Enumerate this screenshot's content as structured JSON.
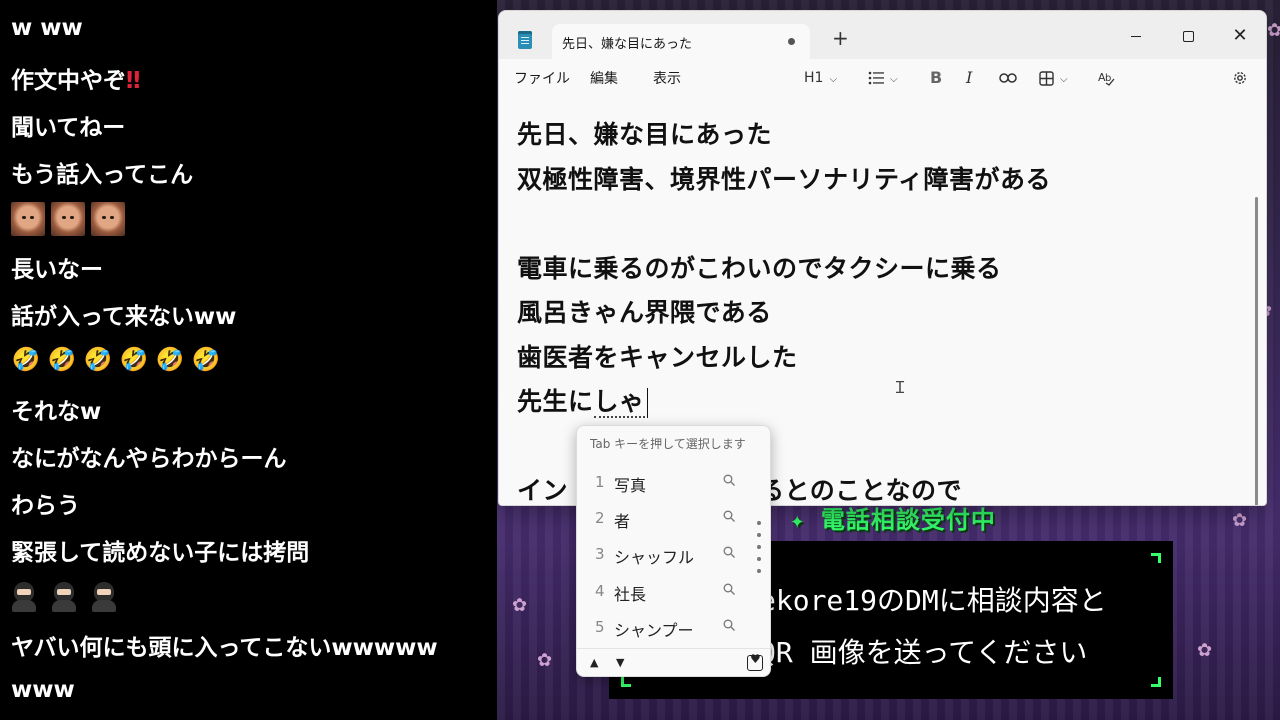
{
  "chat": {
    "lines": [
      {
        "text": "w ww"
      },
      {
        "text": "作文中やぞ",
        "suffix": "‼"
      },
      {
        "text": "聞いてねー"
      },
      {
        "text": "もう話入ってこん"
      },
      {
        "text": "長いなー"
      },
      {
        "text": "話が入って来ないww"
      },
      {
        "text": "それなw"
      },
      {
        "text": "なにがなんやらわからーん"
      },
      {
        "text": "わらう"
      },
      {
        "text": "緊張して読めない子には拷問"
      },
      {
        "text": "ヤバい何にも頭に入ってこないwwwww"
      },
      {
        "text": "www"
      }
    ],
    "emoji_rows": {
      "faces_count": 3,
      "rofl": "🤣",
      "rofl_count": 6,
      "ninja_count": 3
    }
  },
  "notepad": {
    "tab_title": "先日、嫌な目にあった",
    "new_tab_label": "+",
    "window_controls": {
      "minimize": "minimize",
      "maximize": "maximize",
      "close": "✕"
    },
    "menu": {
      "file": "ファイル",
      "edit": "編集",
      "view": "表示"
    },
    "toolbar": {
      "heading": "H1",
      "list_icon": "list-icon",
      "bold": "B",
      "italic": "I"
    },
    "content": {
      "line1": "先日、嫌な目にあった",
      "line2": "双極性障害、境界性パーソナリティ障害がある",
      "line4": "電車に乗るのがこわいのでタクシーに乗る",
      "line5": "風呂きゃん界隈である",
      "line6": "歯医者をキャンセルした",
      "line7_committed": "先生に",
      "line7_composing": "しゃ",
      "line9_start": "イン",
      "line9_end": "かかるとのことなので"
    }
  },
  "ime": {
    "hint": "Tab キーを押して選択します",
    "candidates": [
      {
        "num": "1",
        "text": "写真"
      },
      {
        "num": "2",
        "text": "者"
      },
      {
        "num": "3",
        "text": "シャッフル"
      },
      {
        "num": "4",
        "text": "社長"
      },
      {
        "num": "5",
        "text": "シャンプー"
      }
    ],
    "up": "▲",
    "down": "▼"
  },
  "background": {
    "banner": "電話相談受付中",
    "panel_line1": "ekore19のDMに相談内容と",
    "panel_line2": "QR 画像を送ってください",
    "accent": "#34ff6a"
  }
}
